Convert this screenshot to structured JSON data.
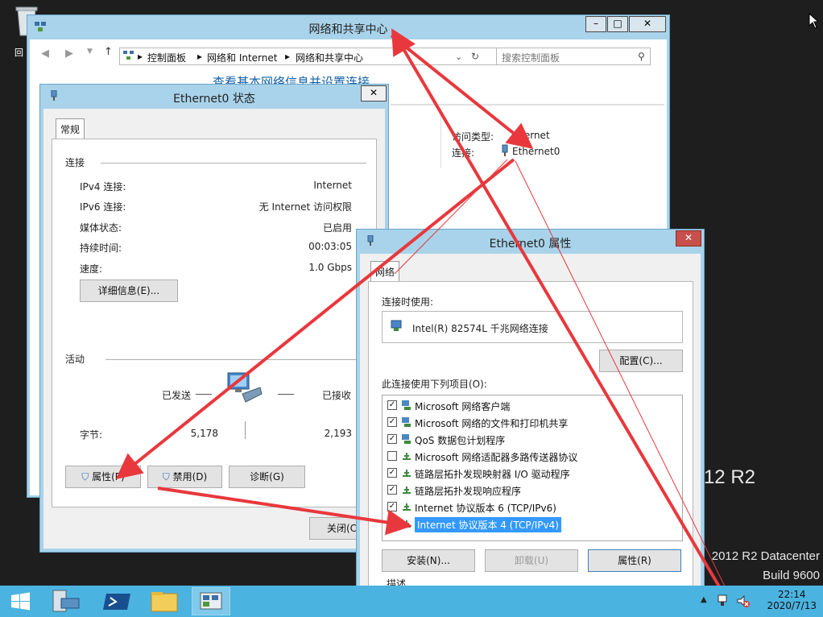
{
  "desktop": {
    "recycle_bin_label": "回",
    "watermark_line1": "012 R2",
    "watermark_line2": "2012 R2 Datacenter",
    "watermark_line3": "Build 9600"
  },
  "network_center": {
    "title": "网络和共享中心",
    "breadcrumb": [
      "控制面板",
      "网络和 Internet",
      "网络和共享中心"
    ],
    "search_placeholder": "搜索控制面板",
    "heading": "查看基本网络信息并设置连接",
    "access_type_label": "访问类型:",
    "access_type_value": "Internet",
    "connections_label": "连接:",
    "connections_value": "Ethernet0"
  },
  "status_dialog": {
    "title": "Ethernet0 状态",
    "tab": "常规",
    "connection_group": "连接",
    "rows": [
      {
        "label": "IPv4 连接:",
        "value": "Internet"
      },
      {
        "label": "IPv6 连接:",
        "value": "无 Internet 访问权限"
      },
      {
        "label": "媒体状态:",
        "value": "已启用"
      },
      {
        "label": "持续时间:",
        "value": "00:03:05"
      },
      {
        "label": "速度:",
        "value": "1.0 Gbps"
      }
    ],
    "details_button": "详细信息(E)...",
    "activity_group": "活动",
    "sent_label": "已发送",
    "received_label": "已接收",
    "bytes_label": "字节:",
    "bytes_sent": "5,178",
    "bytes_received": "2,193",
    "properties_button": "属性(P)",
    "disable_button": "禁用(D)",
    "diagnose_button": "诊断(G)",
    "close_button": "关闭(C)"
  },
  "properties_dialog": {
    "title": "Ethernet0 属性",
    "tab": "网络",
    "connect_using_label": "连接时使用:",
    "adapter": "Intel(R) 82574L 千兆网络连接",
    "configure_button": "配置(C)...",
    "items_label": "此连接使用下列项目(O):",
    "items": [
      {
        "label": "Microsoft 网络客户端",
        "checked": true
      },
      {
        "label": "Microsoft 网络的文件和打印机共享",
        "checked": true
      },
      {
        "label": "QoS 数据包计划程序",
        "checked": true
      },
      {
        "label": "Microsoft 网络适配器多路传送器协议",
        "checked": false
      },
      {
        "label": "链路层拓扑发现映射器 I/O 驱动程序",
        "checked": true
      },
      {
        "label": "链路层拓扑发现响应程序",
        "checked": true
      },
      {
        "label": "Internet 协议版本 6 (TCP/IPv6)",
        "checked": true
      },
      {
        "label": "Internet 协议版本 4 (TCP/IPv4)",
        "checked": true,
        "selected": true
      }
    ],
    "install_button": "安装(N)...",
    "uninstall_button": "卸载(U)",
    "properties_button": "属性(R)",
    "description_label": "描述"
  },
  "taskbar": {
    "time": "22:14",
    "date": "2020/7/13"
  },
  "colors": {
    "window_frame": "#a9d3ea",
    "taskbar": "#4bb3e0",
    "annotation_arrow": "#e8383d",
    "selection": "#3399ff"
  }
}
